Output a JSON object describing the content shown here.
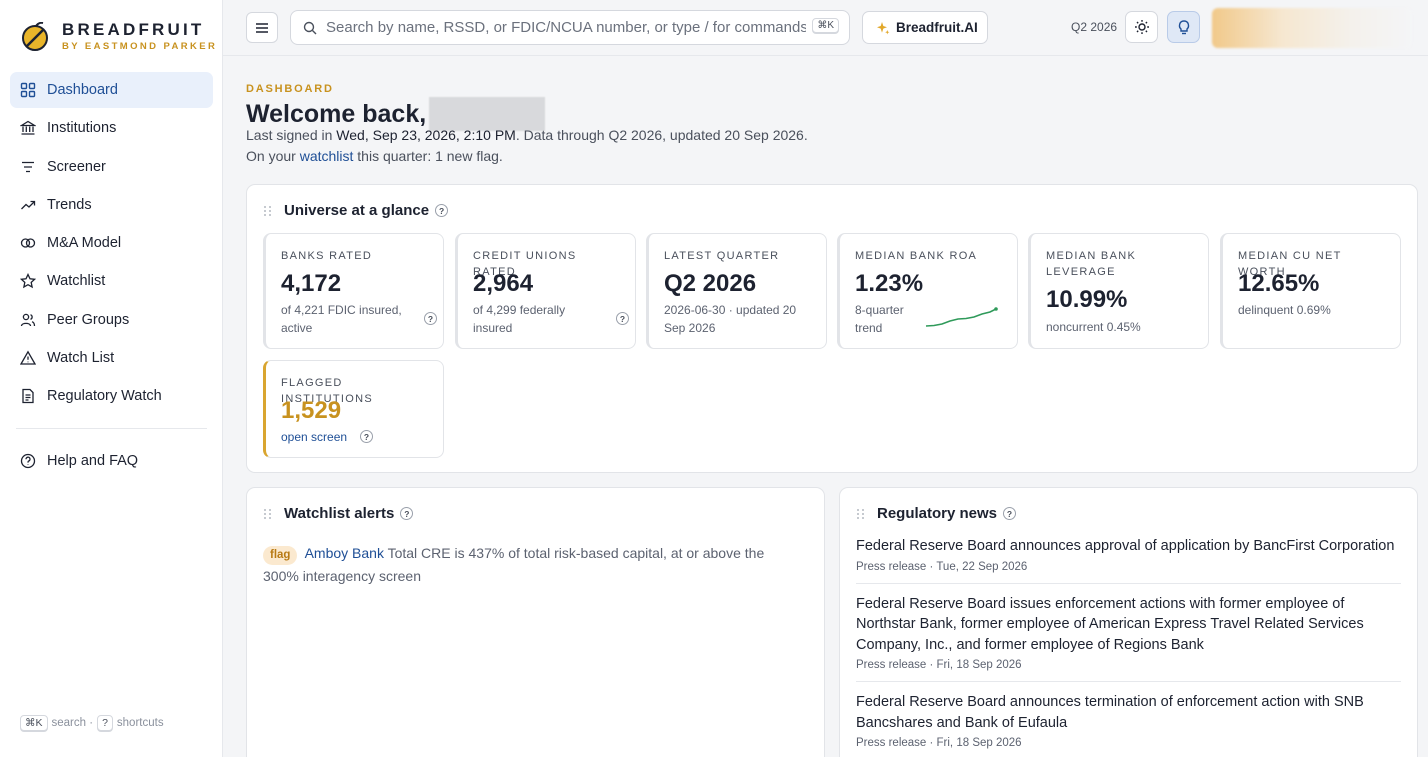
{
  "brand": {
    "name": "BREADFRUIT",
    "sub": "BY EASTMOND PARKER"
  },
  "sidebar": {
    "items": [
      {
        "label": "Dashboard",
        "icon": "grid-icon",
        "active": true
      },
      {
        "label": "Institutions",
        "icon": "bank-icon"
      },
      {
        "label": "Screener",
        "icon": "filter-icon"
      },
      {
        "label": "Trends",
        "icon": "trend-icon"
      },
      {
        "label": "M&A Model",
        "icon": "merge-icon"
      },
      {
        "label": "Watchlist",
        "icon": "star-icon"
      },
      {
        "label": "Peer Groups",
        "icon": "users-icon"
      },
      {
        "label": "Watch List",
        "icon": "warning-icon"
      },
      {
        "label": "Regulatory Watch",
        "icon": "document-icon"
      }
    ],
    "help": {
      "label": "Help and FAQ",
      "icon": "help-icon"
    },
    "hint": {
      "search_key": "⌘K",
      "search_label": "search ·",
      "shortcut_key": "?",
      "shortcut_label": "shortcuts"
    }
  },
  "topbar": {
    "search_placeholder": "Search by name, RSSD, or FDIC/NCUA number, or type / for commands",
    "search_kbd": "⌘K",
    "ai_label": "Breadfruit.AI",
    "quarter": "Q2 2026"
  },
  "header": {
    "eyebrow": "DASHBOARD",
    "welcome": "Welcome back,",
    "last_signed_prefix": "Last signed in",
    "last_signed_date": "Wed, Sep 23, 2026, 2:10 PM",
    "data_through": ". Data through Q2 2026, updated 20 Sep 2026. On your",
    "watchlist_link": "watchlist",
    "flag_text": "this quarter: 1 new flag."
  },
  "universe": {
    "title": "Universe at a glance",
    "stats": [
      {
        "label": "BANKS RATED",
        "value": "4,172",
        "sub": "of 4,221 FDIC insured, active"
      },
      {
        "label": "CREDIT UNIONS RATED",
        "value": "2,964",
        "sub": "of 4,299 federally insured"
      },
      {
        "label": "LATEST QUARTER",
        "value": "Q2 2026",
        "sub": "2026-06-30 · updated 20 Sep 2026"
      },
      {
        "label": "MEDIAN BANK ROA",
        "value": "1.23%",
        "sub": "8-quarter trend"
      },
      {
        "label": "MEDIAN BANK LEVERAGE",
        "value": "10.99%",
        "sub": "noncurrent 0.45%"
      },
      {
        "label": "MEDIAN CU NET WORTH",
        "value": "12.65%",
        "sub": "delinquent 0.69%"
      },
      {
        "label": "FLAGGED INSTITUTIONS",
        "value": "1,529",
        "sub": "open screen"
      }
    ]
  },
  "watchlist_alerts": {
    "title": "Watchlist alerts",
    "alerts": [
      {
        "badge": "flag",
        "bank": "Amboy Bank",
        "text": "Total CRE is 437% of total risk-based capital, at or above the 300% interagency screen"
      }
    ]
  },
  "regulatory_news": {
    "title": "Regulatory news",
    "items": [
      {
        "title": "Federal Reserve Board announces approval of application by BancFirst Corporation",
        "meta": "Press release · Tue, 22 Sep 2026"
      },
      {
        "title": "Federal Reserve Board issues enforcement actions with former employee of Northstar Bank, former employee of American Express Travel Related Services Company, Inc., and former employee of Regions Bank",
        "meta": "Press release · Fri, 18 Sep 2026"
      },
      {
        "title": "Federal Reserve Board announces termination of enforcement action with SNB Bancshares and Bank of Eufaula",
        "meta": "Press release · Fri, 18 Sep 2026"
      }
    ]
  }
}
